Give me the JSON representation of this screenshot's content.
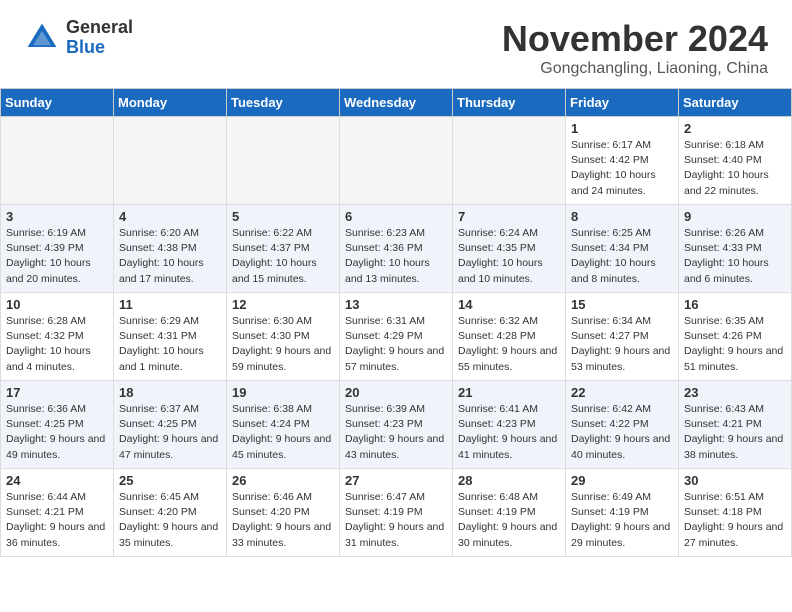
{
  "header": {
    "logo_general": "General",
    "logo_blue": "Blue",
    "month_title": "November 2024",
    "location": "Gongchangling, Liaoning, China"
  },
  "days_of_week": [
    "Sunday",
    "Monday",
    "Tuesday",
    "Wednesday",
    "Thursday",
    "Friday",
    "Saturday"
  ],
  "weeks": [
    [
      {
        "day": "",
        "info": ""
      },
      {
        "day": "",
        "info": ""
      },
      {
        "day": "",
        "info": ""
      },
      {
        "day": "",
        "info": ""
      },
      {
        "day": "",
        "info": ""
      },
      {
        "day": "1",
        "info": "Sunrise: 6:17 AM\nSunset: 4:42 PM\nDaylight: 10 hours and 24 minutes."
      },
      {
        "day": "2",
        "info": "Sunrise: 6:18 AM\nSunset: 4:40 PM\nDaylight: 10 hours and 22 minutes."
      }
    ],
    [
      {
        "day": "3",
        "info": "Sunrise: 6:19 AM\nSunset: 4:39 PM\nDaylight: 10 hours and 20 minutes."
      },
      {
        "day": "4",
        "info": "Sunrise: 6:20 AM\nSunset: 4:38 PM\nDaylight: 10 hours and 17 minutes."
      },
      {
        "day": "5",
        "info": "Sunrise: 6:22 AM\nSunset: 4:37 PM\nDaylight: 10 hours and 15 minutes."
      },
      {
        "day": "6",
        "info": "Sunrise: 6:23 AM\nSunset: 4:36 PM\nDaylight: 10 hours and 13 minutes."
      },
      {
        "day": "7",
        "info": "Sunrise: 6:24 AM\nSunset: 4:35 PM\nDaylight: 10 hours and 10 minutes."
      },
      {
        "day": "8",
        "info": "Sunrise: 6:25 AM\nSunset: 4:34 PM\nDaylight: 10 hours and 8 minutes."
      },
      {
        "day": "9",
        "info": "Sunrise: 6:26 AM\nSunset: 4:33 PM\nDaylight: 10 hours and 6 minutes."
      }
    ],
    [
      {
        "day": "10",
        "info": "Sunrise: 6:28 AM\nSunset: 4:32 PM\nDaylight: 10 hours and 4 minutes."
      },
      {
        "day": "11",
        "info": "Sunrise: 6:29 AM\nSunset: 4:31 PM\nDaylight: 10 hours and 1 minute."
      },
      {
        "day": "12",
        "info": "Sunrise: 6:30 AM\nSunset: 4:30 PM\nDaylight: 9 hours and 59 minutes."
      },
      {
        "day": "13",
        "info": "Sunrise: 6:31 AM\nSunset: 4:29 PM\nDaylight: 9 hours and 57 minutes."
      },
      {
        "day": "14",
        "info": "Sunrise: 6:32 AM\nSunset: 4:28 PM\nDaylight: 9 hours and 55 minutes."
      },
      {
        "day": "15",
        "info": "Sunrise: 6:34 AM\nSunset: 4:27 PM\nDaylight: 9 hours and 53 minutes."
      },
      {
        "day": "16",
        "info": "Sunrise: 6:35 AM\nSunset: 4:26 PM\nDaylight: 9 hours and 51 minutes."
      }
    ],
    [
      {
        "day": "17",
        "info": "Sunrise: 6:36 AM\nSunset: 4:25 PM\nDaylight: 9 hours and 49 minutes."
      },
      {
        "day": "18",
        "info": "Sunrise: 6:37 AM\nSunset: 4:25 PM\nDaylight: 9 hours and 47 minutes."
      },
      {
        "day": "19",
        "info": "Sunrise: 6:38 AM\nSunset: 4:24 PM\nDaylight: 9 hours and 45 minutes."
      },
      {
        "day": "20",
        "info": "Sunrise: 6:39 AM\nSunset: 4:23 PM\nDaylight: 9 hours and 43 minutes."
      },
      {
        "day": "21",
        "info": "Sunrise: 6:41 AM\nSunset: 4:23 PM\nDaylight: 9 hours and 41 minutes."
      },
      {
        "day": "22",
        "info": "Sunrise: 6:42 AM\nSunset: 4:22 PM\nDaylight: 9 hours and 40 minutes."
      },
      {
        "day": "23",
        "info": "Sunrise: 6:43 AM\nSunset: 4:21 PM\nDaylight: 9 hours and 38 minutes."
      }
    ],
    [
      {
        "day": "24",
        "info": "Sunrise: 6:44 AM\nSunset: 4:21 PM\nDaylight: 9 hours and 36 minutes."
      },
      {
        "day": "25",
        "info": "Sunrise: 6:45 AM\nSunset: 4:20 PM\nDaylight: 9 hours and 35 minutes."
      },
      {
        "day": "26",
        "info": "Sunrise: 6:46 AM\nSunset: 4:20 PM\nDaylight: 9 hours and 33 minutes."
      },
      {
        "day": "27",
        "info": "Sunrise: 6:47 AM\nSunset: 4:19 PM\nDaylight: 9 hours and 31 minutes."
      },
      {
        "day": "28",
        "info": "Sunrise: 6:48 AM\nSunset: 4:19 PM\nDaylight: 9 hours and 30 minutes."
      },
      {
        "day": "29",
        "info": "Sunrise: 6:49 AM\nSunset: 4:19 PM\nDaylight: 9 hours and 29 minutes."
      },
      {
        "day": "30",
        "info": "Sunrise: 6:51 AM\nSunset: 4:18 PM\nDaylight: 9 hours and 27 minutes."
      }
    ]
  ]
}
